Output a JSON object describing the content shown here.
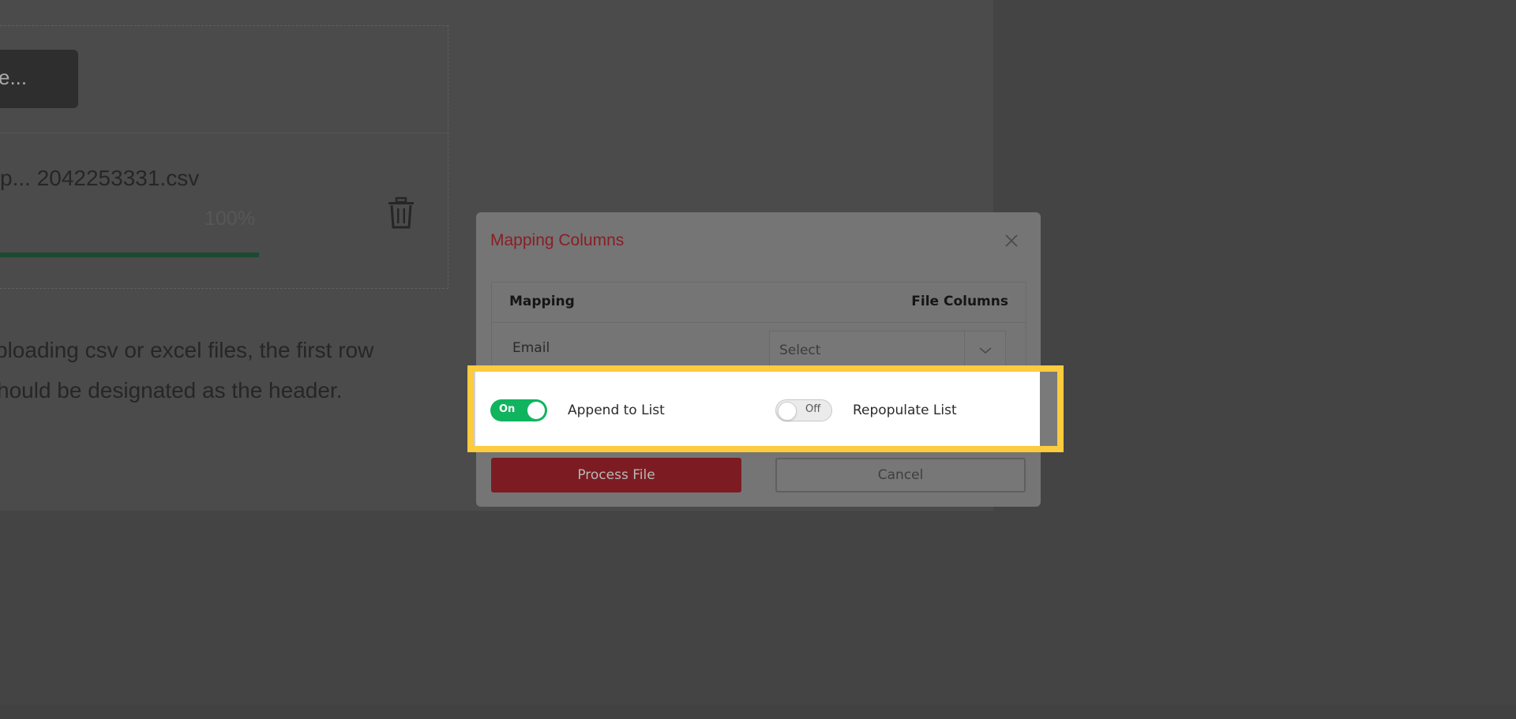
{
  "background": {
    "browse_label": "e...",
    "file_name": "p... 2042253331.csv",
    "progress_text": "100%",
    "progress_value": 100,
    "note_lines": [
      "ploading csv or excel files, the first row",
      "hould be designated as the header."
    ]
  },
  "modal": {
    "title": "Mapping Columns",
    "table": {
      "headers": {
        "mapping": "Mapping",
        "file_columns": "File Columns"
      },
      "rows": [
        {
          "label": "Email",
          "select_value": "Select"
        }
      ]
    },
    "toggles": {
      "append": {
        "state_text": "On",
        "label": "Append to List",
        "on": true
      },
      "repopulate": {
        "state_text": "Off",
        "label": "Repopulate List",
        "on": false
      }
    },
    "buttons": {
      "process": "Process File",
      "cancel": "Cancel"
    }
  },
  "colors": {
    "highlight": "#fccb3e",
    "toggle_on": "#10b45f",
    "brand_red": "#8a1e25"
  }
}
